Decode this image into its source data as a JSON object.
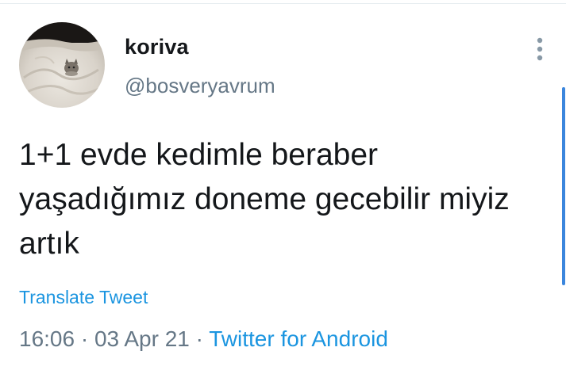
{
  "tweet": {
    "display_name": "koriva",
    "handle": "@bosveryavrum",
    "text": "1+1 evde kedimle beraber yaşadığımız doneme gecebilir miyiz artık",
    "translate_label": "Translate Tweet",
    "time": "16:06",
    "separator_1": " · ",
    "date": "03 Apr 21",
    "separator_2": " · ",
    "source": "Twitter for Android"
  },
  "icons": {
    "more": "more-vertical-icon",
    "avatar": "cat-on-blanket-avatar"
  },
  "colors": {
    "text": "#14171a",
    "secondary": "#657786",
    "link": "#1b95e0",
    "scrollbar": "#3b86dd"
  }
}
